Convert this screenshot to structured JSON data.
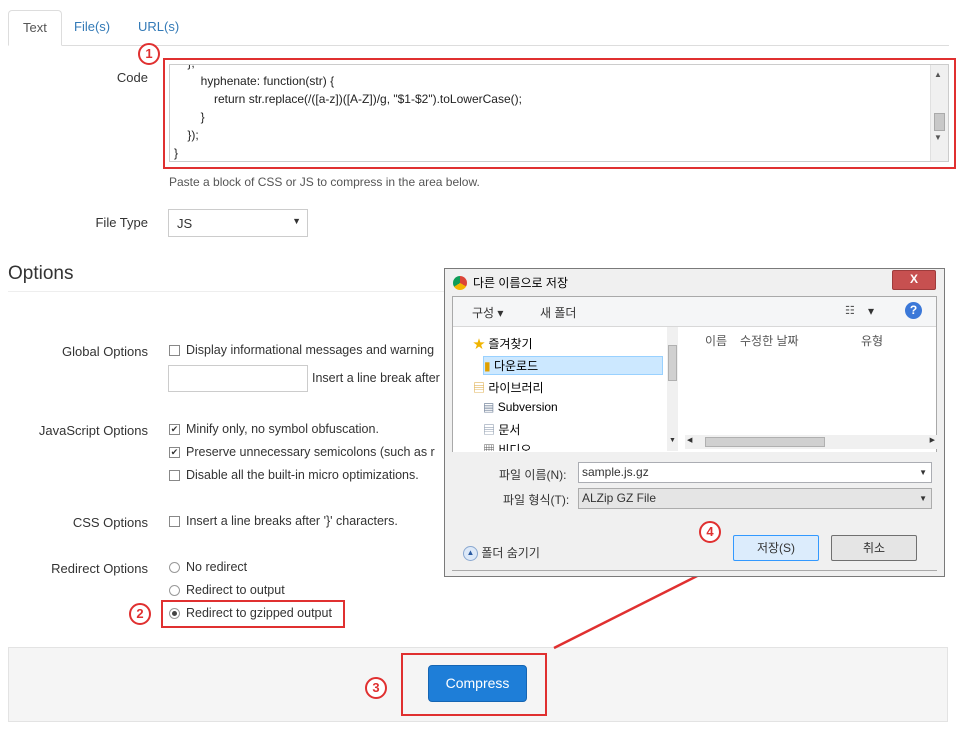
{
  "tabs": [
    {
      "label": "Text"
    },
    {
      "label": "File(s)"
    },
    {
      "label": "URL(s)"
    }
  ],
  "form": {
    "code_label": "Code",
    "code_lines": "    },\n        hyphenate: function(str) {\n            return str.replace(/([a-z])([A-Z])/g, \"$1-$2\").toLowerCase();\n        }\n    });\n}",
    "code_hint": "Paste a block of CSS or JS to compress in the area below.",
    "file_type_label": "File Type",
    "file_type_value": "JS"
  },
  "options": {
    "heading": "Options",
    "global_label": "Global Options",
    "global_display": "Display informational messages and warning",
    "global_linebreak": "Insert a line break after",
    "js_label": "JavaScript Options",
    "js_minify": "Minify only, no symbol obfuscation.",
    "js_semicolons": "Preserve unnecessary semicolons (such as r",
    "js_micro": "Disable all the built-in micro optimizations.",
    "css_label": "CSS Options",
    "css_linebreak": "Insert a line breaks after '}' characters.",
    "redirect_label": "Redirect Options",
    "redirect_none": "No redirect",
    "redirect_output": "Redirect to output",
    "redirect_gzip": "Redirect to gzipped output"
  },
  "compress_label": "Compress",
  "markers": [
    "1",
    "2",
    "3",
    "4"
  ],
  "dialog": {
    "title": "다른 이름으로 저장",
    "close": "X",
    "organize": "구성 ▾",
    "new_folder": "새 폴더",
    "view": "▾",
    "help": "?",
    "nav_items": [
      "즐겨찾기",
      "다운로드",
      "라이브러리",
      "Subversion",
      "문서",
      "비디오"
    ],
    "columns": [
      "이름",
      "수정한 날짜",
      "유형"
    ],
    "filename_label": "파일 이름(N):",
    "filename_value": "sample.js.gz",
    "filetype_label": "파일 형식(T):",
    "filetype_value": "ALZip GZ File",
    "hide_folders": "폴더 숨기기",
    "save": "저장(S)",
    "cancel": "취소"
  },
  "colors": {
    "accent": "#1e7ed8",
    "annotation": "#e03030"
  }
}
